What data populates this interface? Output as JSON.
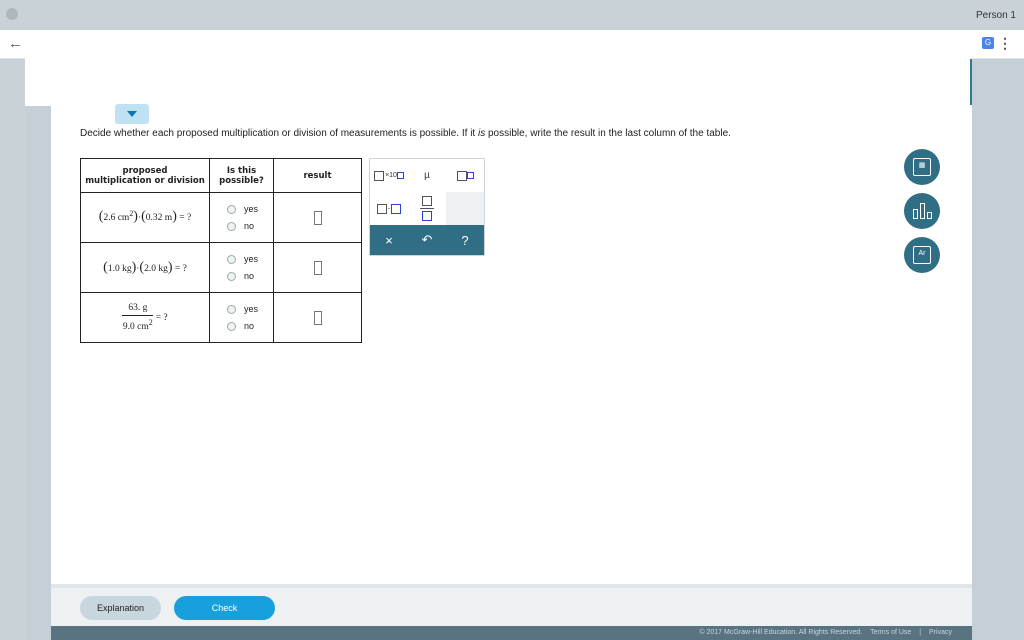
{
  "browser": {
    "profile_name": "Person 1",
    "back_icon": "arrow-left-icon",
    "translate_icon": "translate-icon",
    "menu_icon": "more-vert-icon"
  },
  "question": {
    "text_before": "Decide whether each proposed multiplication or division of measurements is possible. If it ",
    "text_is": "is",
    "text_after": " possible, write the result in the last column of the table."
  },
  "table": {
    "headers": {
      "col1_line1": "proposed",
      "col1_line2": "multiplication or division",
      "col2_line1": "Is this",
      "col2_line2": "possible?",
      "col3": "result"
    },
    "rows": [
      {
        "a": "2.6 cm",
        "a_exp": "2",
        "b": "0.32 m",
        "tail": "= ?",
        "yes": "yes",
        "no": "no"
      },
      {
        "a": "1.0 kg",
        "b": "2.0 kg",
        "tail": "= ?",
        "yes": "yes",
        "no": "no"
      },
      {
        "num": "63. g",
        "den": "9.0 cm",
        "den_exp": "2",
        "tail": "= ?",
        "yes": "yes",
        "no": "no"
      }
    ]
  },
  "palette": {
    "x10_label": "×10",
    "mu_label": "µ",
    "actions": {
      "clear": "×",
      "undo": "↶",
      "help": "?"
    }
  },
  "tools": [
    {
      "name": "calculator-icon"
    },
    {
      "name": "bar-chart-icon"
    },
    {
      "name": "periodic-table-icon",
      "label": "Ar"
    }
  ],
  "footer": {
    "explanation_label": "Explanation",
    "check_label": "Check",
    "copyright": "© 2017 McGraw-Hill Education. All Rights Reserved.",
    "terms": "Terms of Use",
    "separator": "|",
    "privacy": "Privacy"
  }
}
